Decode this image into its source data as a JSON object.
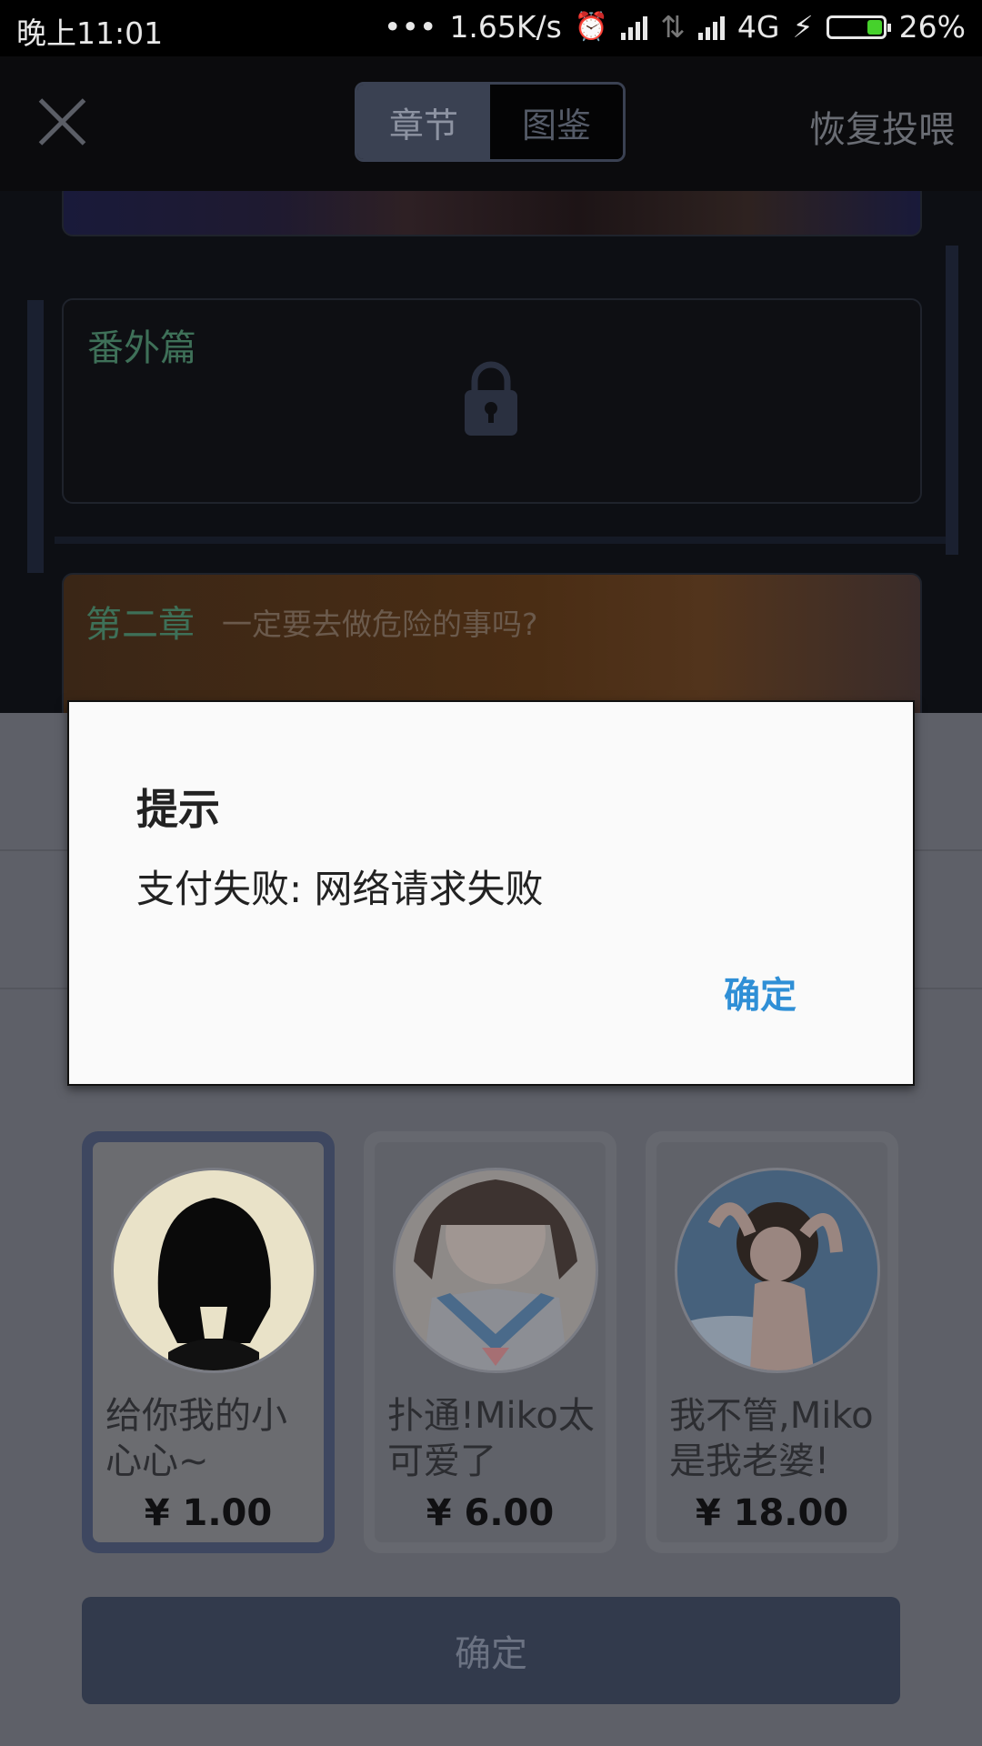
{
  "status_bar": {
    "time": "晚上11:01",
    "dots": "•••",
    "net_speed": "1.65K/s",
    "network": "4G",
    "battery": "26%",
    "icons": [
      "alarm-icon",
      "signal-icon",
      "data-arrows-icon",
      "charging-icon",
      "battery-icon"
    ]
  },
  "header": {
    "close_icon": "close-icon",
    "tabs": [
      {
        "label": "章节",
        "selected": true
      },
      {
        "label": "图鉴",
        "selected": false
      }
    ],
    "restore_label": "恢复投喂"
  },
  "chapters": [
    {
      "title": "番外篇",
      "subtitle": "",
      "locked": true
    },
    {
      "title": "第二章",
      "subtitle": "一定要去做危险的事吗?",
      "locked": false
    }
  ],
  "gifts": [
    {
      "name": "给你我的小心心~",
      "price": "¥ 1.00",
      "selected": true
    },
    {
      "name": "扑通!Miko太可爱了",
      "price": "¥ 6.00",
      "selected": false
    },
    {
      "name": "我不管,Miko是我老婆!",
      "price": "¥ 18.00",
      "selected": false
    }
  ],
  "confirm_label": "确定",
  "dialog": {
    "title": "提示",
    "message": "支付失败: 网络请求失败",
    "ok_label": "确定"
  },
  "colors": {
    "accent_blue": "#2f8fd6",
    "chapter_green": "#3e7058",
    "selected_border": "#3e4760",
    "battery_green": "#46d12c"
  }
}
